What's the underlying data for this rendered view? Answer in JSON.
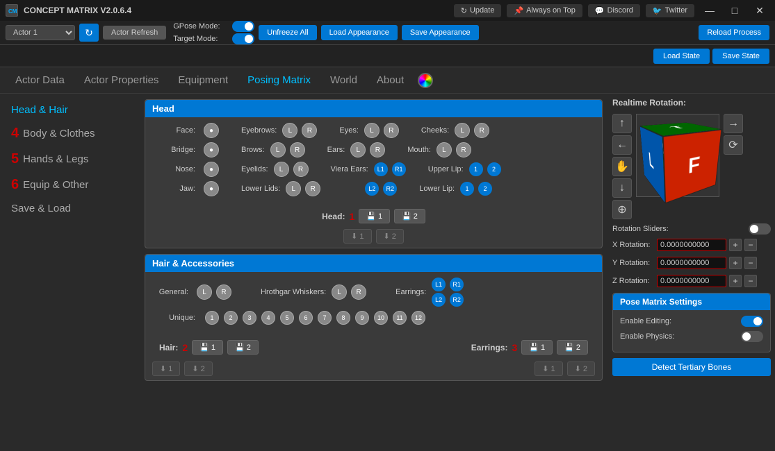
{
  "app": {
    "title": "CONCEPT MATRIX V2.0.6.4",
    "icon": "CM"
  },
  "title_buttons": [
    {
      "label": "Update",
      "icon": "↻"
    },
    {
      "label": "Always on Top",
      "icon": "📌"
    },
    {
      "label": "Discord",
      "icon": "💬"
    },
    {
      "label": "Twitter",
      "icon": "🐦"
    }
  ],
  "toolbar": {
    "actor_refresh": "Actor Refresh",
    "gpose_label": "GPose Mode:",
    "target_label": "Target Mode:",
    "unfreeze_all": "Unfreeze All",
    "load_appearance": "Load Appearance",
    "save_appearance": "Save Appearance",
    "reload_process": "Reload Process",
    "load_state": "Load State",
    "save_state": "Save State"
  },
  "nav": {
    "items": [
      {
        "label": "Actor Data"
      },
      {
        "label": "Actor Properties"
      },
      {
        "label": "Equipment"
      },
      {
        "label": "Posing Matrix",
        "active": true
      },
      {
        "label": "World"
      },
      {
        "label": "About"
      }
    ]
  },
  "sidebar": {
    "items": [
      {
        "label": "Head & Hair",
        "active": true
      },
      {
        "label": "Body & Clothes",
        "num": "4"
      },
      {
        "label": "Hands & Legs",
        "num": "5"
      },
      {
        "label": "Equip & Other",
        "num": "6"
      },
      {
        "label": "Save & Load"
      }
    ]
  },
  "head_section": {
    "title": "Head",
    "rows": [
      [
        {
          "label": "Face:",
          "buttons": [
            "●"
          ]
        },
        {
          "label": "Eyebrows:",
          "buttons": [
            "L",
            "R"
          ]
        },
        {
          "label": "Eyes:",
          "buttons": [
            "L",
            "R"
          ]
        },
        {
          "label": "Cheeks:",
          "buttons": [
            "L",
            "R"
          ]
        }
      ],
      [
        {
          "label": "Bridge:",
          "buttons": [
            "●"
          ]
        },
        {
          "label": "Brows:",
          "buttons": [
            "L",
            "R"
          ]
        },
        {
          "label": "Ears:",
          "buttons": [
            "L",
            "R"
          ]
        },
        {
          "label": "Mouth:",
          "buttons": [
            "L",
            "R"
          ]
        }
      ],
      [
        {
          "label": "Nose:",
          "buttons": [
            "●"
          ]
        },
        {
          "label": "Eyelids:",
          "buttons": [
            "L",
            "R"
          ]
        },
        {
          "label": "Viera Ears:",
          "buttons": [
            "L1",
            "R1"
          ]
        },
        {
          "label": "Upper Lip:",
          "buttons": [
            "1",
            "2"
          ]
        }
      ],
      [
        {
          "label": "Jaw:",
          "buttons": [
            "●"
          ]
        },
        {
          "label": "Lower Lids:",
          "buttons": [
            "L",
            "R"
          ]
        },
        {
          "label": "",
          "buttons": [
            "L2",
            "R2"
          ]
        },
        {
          "label": "Lower Lip:",
          "buttons": [
            "1",
            "2"
          ]
        }
      ]
    ],
    "save_label": "Head:",
    "save_num": "1",
    "save_slots": [
      "💾 1",
      "💾 2"
    ],
    "load_slots": [
      "⬇ 1",
      "⬇ 2"
    ]
  },
  "hair_section": {
    "title": "Hair & Accessories",
    "rows": [
      {
        "label": "General:",
        "buttons": [
          "L",
          "R"
        ]
      },
      {
        "label": "Hrothgar Whiskers:",
        "buttons": [
          "L",
          "R"
        ]
      },
      {
        "label": "Earrings:",
        "earring_rows": [
          [
            "L1",
            "R1"
          ],
          [
            "L2",
            "R2"
          ]
        ]
      },
      {
        "label": "Unique:",
        "unique_buttons": [
          "1",
          "2",
          "3",
          "4",
          "5",
          "6",
          "7",
          "8",
          "9",
          "10",
          "11",
          "12"
        ]
      }
    ],
    "hair_label": "Hair:",
    "hair_num": "2",
    "hair_slots": [
      "💾 1",
      "💾 2"
    ],
    "hair_load": [
      "⬇ 1",
      "⬇ 2"
    ],
    "earrings_label": "Earrings:",
    "earrings_num": "3",
    "earrings_slots": [
      "💾 1",
      "💾 2"
    ],
    "earrings_load": [
      "⬇ 1",
      "⬇ 2"
    ]
  },
  "rotation": {
    "title": "Realtime Rotation:",
    "sliders_label": "Rotation Sliders:",
    "x_label": "X Rotation:",
    "y_label": "Y Rotation:",
    "z_label": "Z Rotation:",
    "x_val": "0.0000000000",
    "y_val": "0.0000000000",
    "z_val": "0.0000000000"
  },
  "pose_settings": {
    "title": "Pose Matrix Settings",
    "editing_label": "Enable Editing:",
    "physics_label": "Enable Physics:",
    "detect_btn": "Detect Tertiary Bones"
  }
}
